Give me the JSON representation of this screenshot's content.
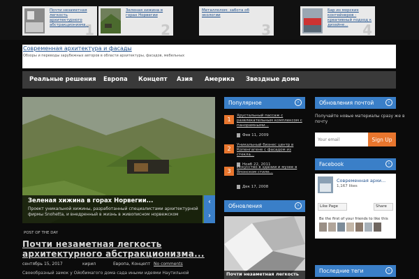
{
  "top_posts": [
    {
      "title": "Почти незаметная легкость архитектурного абстракционизма...",
      "num": "1"
    },
    {
      "title": "Зеленая хижина в горах Норвегии",
      "num": "2"
    },
    {
      "title": "Металлолом: забота об экологии",
      "num": "3"
    },
    {
      "title": "Бар из морских контейнеров - креативный подход к дизайне...",
      "num": "4"
    }
  ],
  "site": {
    "title": "Современная архитектура и фасады",
    "description": "Обзоры и переводы зарубежных авторов в области архитектуры, фасадов, мебельных"
  },
  "nav": [
    "Реальные решения",
    "Европа",
    "Концепт",
    "Азия",
    "Америка",
    "Звездные дома"
  ],
  "featured": {
    "title": "Зеленая хижина в горах Норвегии...",
    "text": "Проект уникальной хижины, разработанный специалистами архитектурной фирмы Snohetta, и внедренный в жизнь в живописном норвежском"
  },
  "post_of_day": {
    "label": "POST OF THE DAY",
    "title": "Почти незаметная легкость архитектурного абстракционизма...",
    "date": "сентябрь 15, 2017",
    "author": "кирил",
    "categories": "Европа, Концепт",
    "comments": "No comments",
    "text": "Своеобразный замок у Ойобимагого дома сада иными идеями Наутильной"
  },
  "widgets": {
    "popular": {
      "title": "Популярное",
      "items": [
        {
          "num": "1",
          "title": "Хрустальный пассаж с развлекательным комплексом с панорамными...",
          "date": "Фев 11, 2009"
        },
        {
          "num": "2",
          "title": "Уникальный бизнес центр в Копенгагене с фасадом из стекла...",
          "date": "Нояб 22, 2011"
        },
        {
          "num": "3",
          "title": "Искусство в здании и музее в Японском стиле...",
          "date": "Дек 17, 2008"
        }
      ]
    },
    "updates": {
      "title": "Обновления",
      "caption": "Почти незаметная легкость"
    },
    "mail": {
      "title": "Обновления почтой",
      "text": "Получайте новые материалы сразу же в почту",
      "placeholder": "Your email",
      "button": "Sign Up"
    },
    "facebook": {
      "title": "Facebook",
      "page_name": "Современная архи...",
      "likes": "1,167 likes",
      "like_button": "Like Page",
      "share_button": "Share",
      "first_text": "Be the first of your friends to like this"
    },
    "tags": {
      "title": "Последние теги"
    }
  },
  "colors": {
    "accent": "#3a7fc8",
    "orange": "#e8762e",
    "nav_bg": "#3a3a3a",
    "page_bg": "#0b0b0b"
  }
}
